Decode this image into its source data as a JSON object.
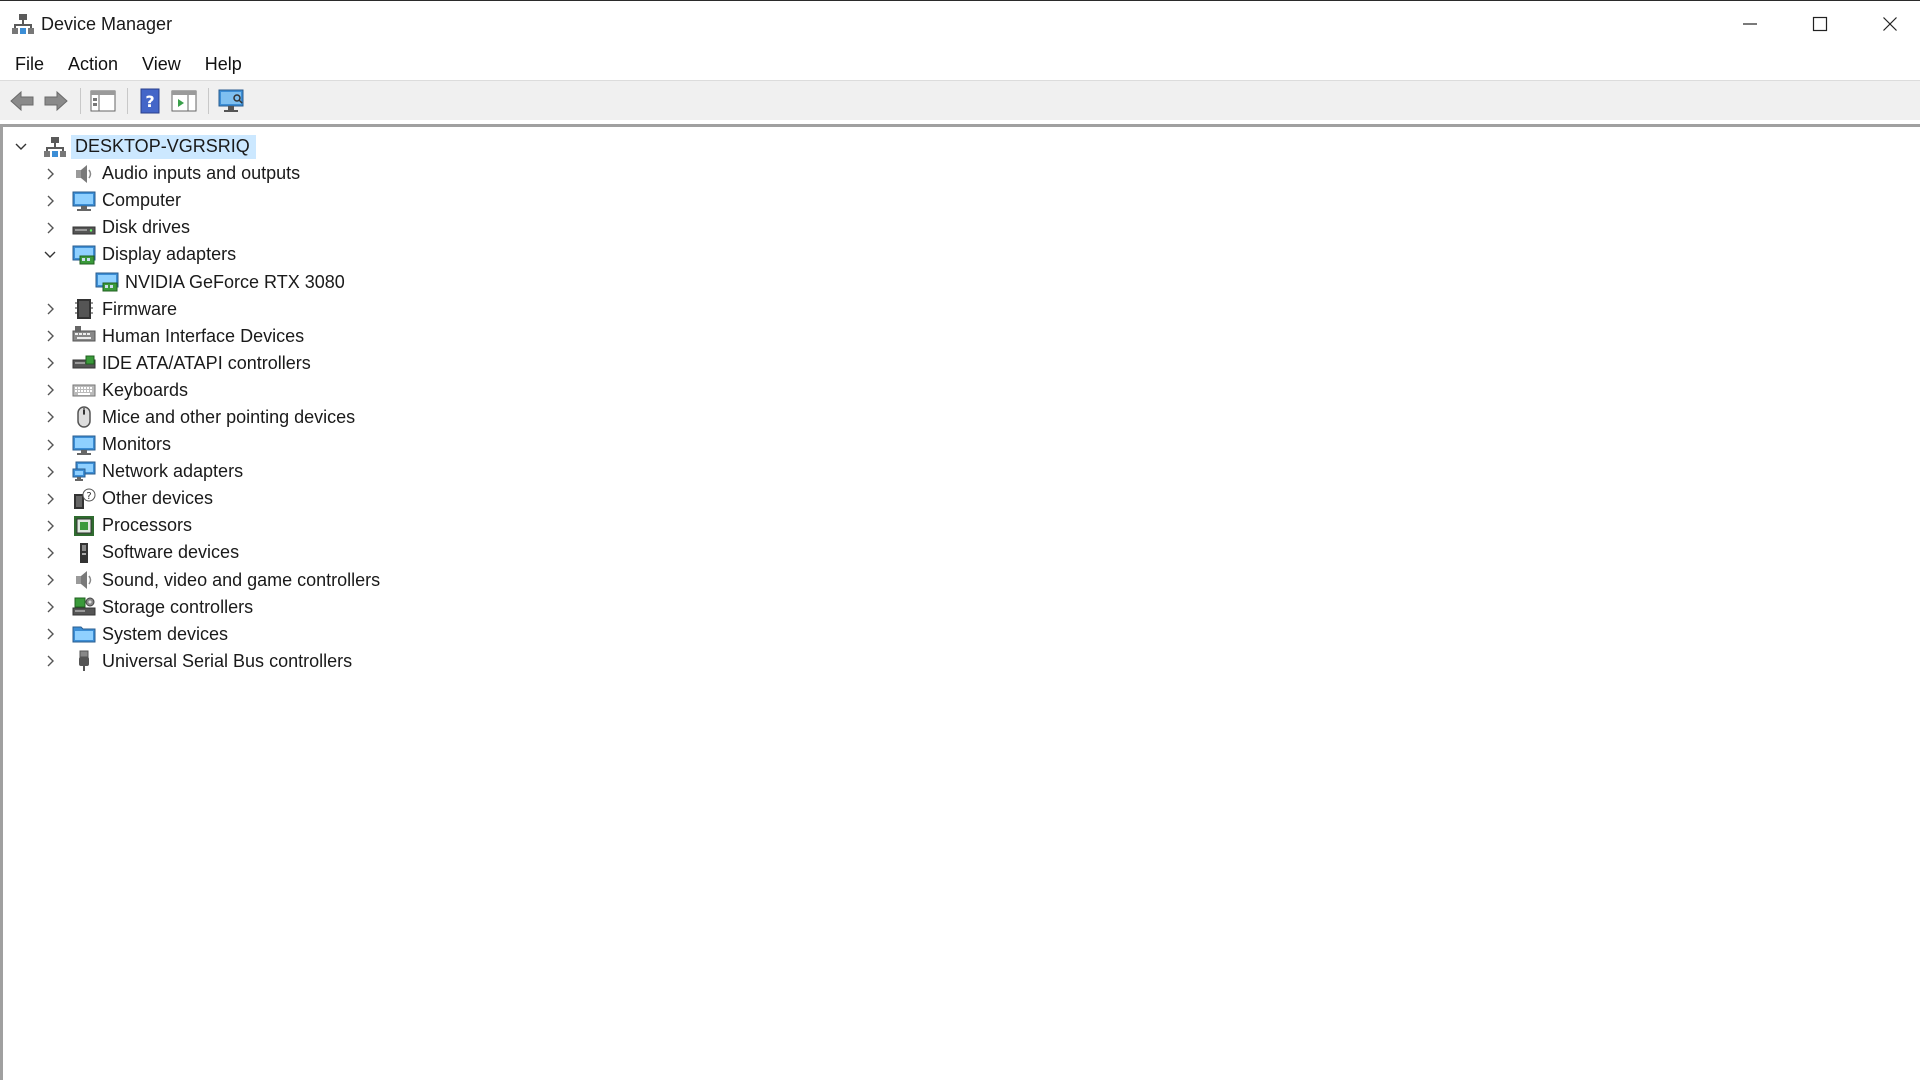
{
  "window": {
    "title": "Device Manager"
  },
  "menu": [
    "File",
    "Action",
    "View",
    "Help"
  ],
  "toolbar": {
    "buttons": [
      "back-icon",
      "forward-icon",
      "properties-pane-icon",
      "help-icon",
      "action-pane-icon",
      "monitor-scan-icon"
    ]
  },
  "tree": {
    "root": {
      "label": "DESKTOP-VGRSRIQ",
      "expanded": true,
      "selected": true
    },
    "categories": [
      {
        "label": "Audio inputs and outputs",
        "icon": "speaker-icon",
        "expanded": false
      },
      {
        "label": "Computer",
        "icon": "computer-icon",
        "expanded": false
      },
      {
        "label": "Disk drives",
        "icon": "disk-drive-icon",
        "expanded": false
      },
      {
        "label": "Display adapters",
        "icon": "display-adapter-icon",
        "expanded": true,
        "children": [
          {
            "label": "NVIDIA GeForce RTX 3080",
            "icon": "display-adapter-icon"
          }
        ]
      },
      {
        "label": "Firmware",
        "icon": "firmware-icon",
        "expanded": false
      },
      {
        "label": "Human Interface Devices",
        "icon": "hid-icon",
        "expanded": false
      },
      {
        "label": "IDE ATA/ATAPI controllers",
        "icon": "ide-controller-icon",
        "expanded": false
      },
      {
        "label": "Keyboards",
        "icon": "keyboard-icon",
        "expanded": false
      },
      {
        "label": "Mice and other pointing devices",
        "icon": "mouse-icon",
        "expanded": false
      },
      {
        "label": "Monitors",
        "icon": "monitor-icon",
        "expanded": false
      },
      {
        "label": "Network adapters",
        "icon": "network-adapter-icon",
        "expanded": false
      },
      {
        "label": "Other devices",
        "icon": "other-devices-icon",
        "expanded": false
      },
      {
        "label": "Processors",
        "icon": "processor-icon",
        "expanded": false
      },
      {
        "label": "Software devices",
        "icon": "software-device-icon",
        "expanded": false
      },
      {
        "label": "Sound, video and game controllers",
        "icon": "speaker-icon",
        "expanded": false
      },
      {
        "label": "Storage controllers",
        "icon": "storage-controller-icon",
        "expanded": false
      },
      {
        "label": "System devices",
        "icon": "system-devices-icon",
        "expanded": false
      },
      {
        "label": "Universal Serial Bus controllers",
        "icon": "usb-icon",
        "expanded": false
      }
    ]
  },
  "colors": {
    "selection": "#cce8ff",
    "accent": "#3c8ed6"
  }
}
